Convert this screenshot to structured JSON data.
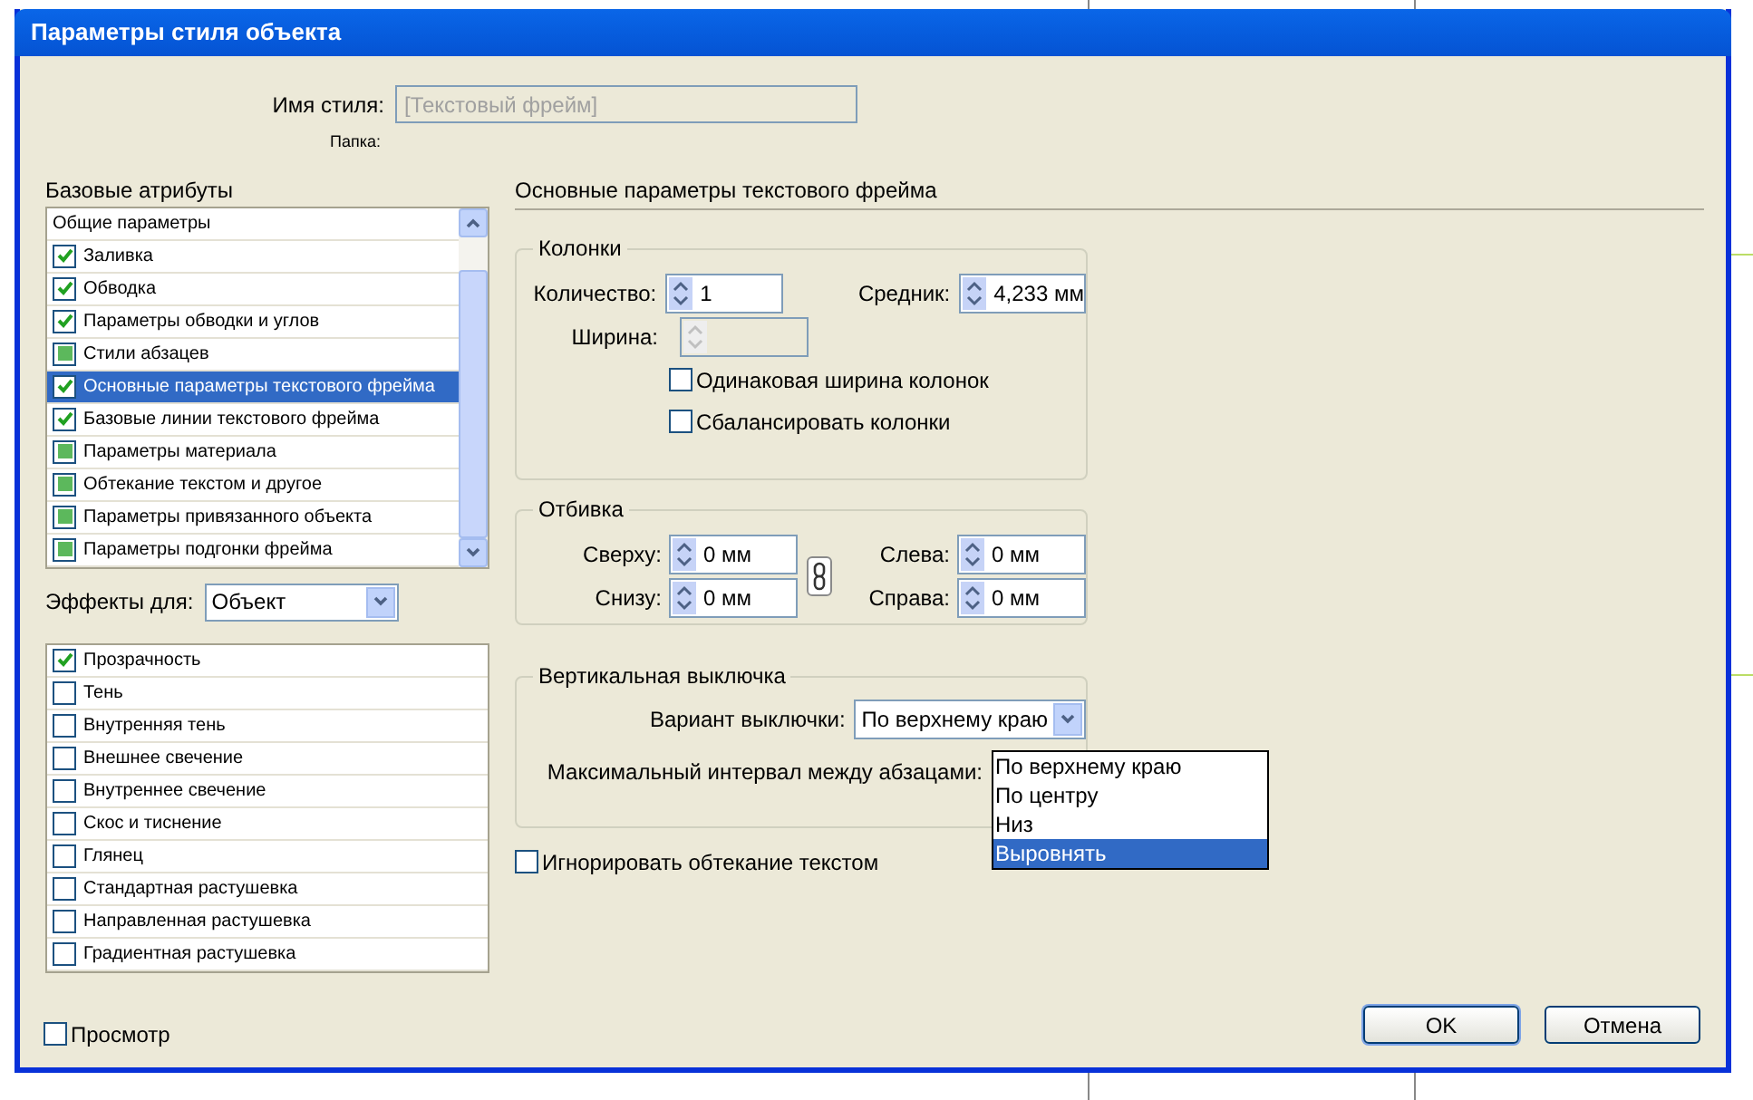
{
  "window": {
    "title": "Параметры стиля объекта"
  },
  "style_name": {
    "label": "Имя стиля:",
    "value": "[Текстовый фрейм]",
    "disabled": true
  },
  "folder": {
    "label": "Папка:"
  },
  "basic_attributes": {
    "heading": "Базовые атрибуты",
    "items": [
      {
        "label": "Общие параметры",
        "kind": "plain",
        "selected": false
      },
      {
        "label": "Заливка",
        "kind": "checkbox",
        "checked": true,
        "selected": false
      },
      {
        "label": "Обводка",
        "kind": "checkbox",
        "checked": true,
        "selected": false
      },
      {
        "label": "Параметры обводки и углов",
        "kind": "checkbox",
        "checked": true,
        "selected": false
      },
      {
        "label": "Стили абзацев",
        "kind": "checkbox",
        "checked": false,
        "selected": false
      },
      {
        "label": "Основные параметры текстового фрейма",
        "kind": "checkbox",
        "checked": true,
        "selected": true
      },
      {
        "label": "Базовые линии текстового фрейма",
        "kind": "checkbox",
        "checked": true,
        "selected": false
      },
      {
        "label": "Параметры материала",
        "kind": "checkbox",
        "checked": false,
        "selected": false
      },
      {
        "label": "Обтекание текстом и другое",
        "kind": "checkbox",
        "checked": false,
        "selected": false
      },
      {
        "label": "Параметры привязанного объекта",
        "kind": "checkbox",
        "checked": false,
        "selected": false
      },
      {
        "label": "Параметры подгонки фрейма",
        "kind": "checkbox",
        "checked": false,
        "selected": false
      }
    ]
  },
  "effects_for": {
    "label": "Эффекты для:",
    "value": "Объект"
  },
  "effects": [
    {
      "label": "Прозрачность",
      "checked": true
    },
    {
      "label": "Тень",
      "checked": false
    },
    {
      "label": "Внутренняя тень",
      "checked": false
    },
    {
      "label": "Внешнее свечение",
      "checked": false
    },
    {
      "label": "Внутреннее свечение",
      "checked": false
    },
    {
      "label": "Скос и тиснение",
      "checked": false
    },
    {
      "label": "Глянец",
      "checked": false
    },
    {
      "label": "Стандартная растушевка",
      "checked": false
    },
    {
      "label": "Направленная растушевка",
      "checked": false
    },
    {
      "label": "Градиентная растушевка",
      "checked": false
    }
  ],
  "preview": {
    "label": "Просмотр",
    "checked": false
  },
  "section_title": "Основные параметры текстового фрейма",
  "columns": {
    "legend": "Колонки",
    "count": {
      "label": "Количество:",
      "value": "1"
    },
    "gutter": {
      "label": "Средник:",
      "value": "4,233 мм"
    },
    "width": {
      "label": "Ширина:",
      "disabled": true
    },
    "equal_width": {
      "label": "Одинаковая ширина колонок",
      "checked": false
    },
    "balance": {
      "label": "Сбалансировать колонки",
      "checked": false
    }
  },
  "inset": {
    "legend": "Отбивка",
    "top": {
      "label": "Сверху:",
      "value": "0 мм"
    },
    "bottom": {
      "label": "Снизу:",
      "value": "0 мм"
    },
    "left": {
      "label": "Слева:",
      "value": "0 мм"
    },
    "right": {
      "label": "Справа:",
      "value": "0 мм"
    }
  },
  "vertical_justification": {
    "legend": "Вертикальная выключка",
    "align": {
      "label": "Вариант выключки:",
      "value": "По верхнему краю"
    },
    "max_spacing": {
      "label": "Максимальный интервал между абзацами:"
    },
    "options": [
      {
        "label": "По верхнему краю",
        "selected": false
      },
      {
        "label": "По центру",
        "selected": false
      },
      {
        "label": "Низ",
        "selected": false
      },
      {
        "label": "Выровнять",
        "selected": true
      }
    ]
  },
  "ignore_wrap": {
    "label": "Игнорировать обтекание текстом",
    "checked": false
  },
  "buttons": [
    {
      "label": "OK",
      "default": true
    },
    {
      "label": "Отмена",
      "default": false
    }
  ]
}
